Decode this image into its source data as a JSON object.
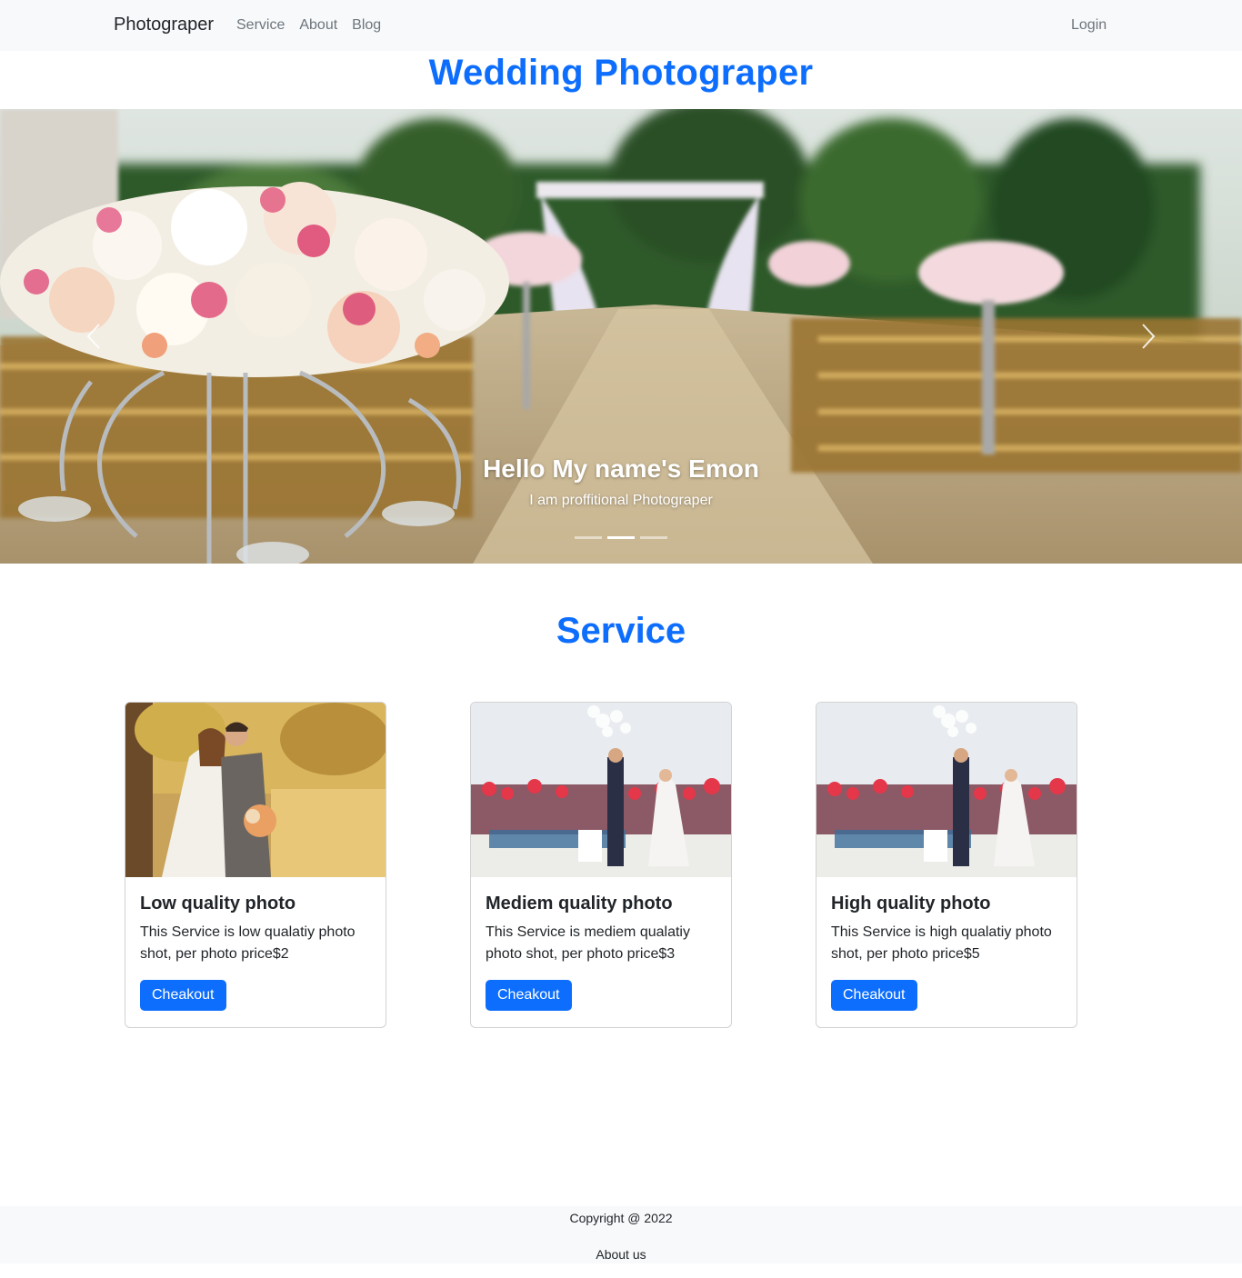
{
  "navbar": {
    "brand": "Photograper",
    "links": [
      "Service",
      "About",
      "Blog"
    ],
    "login": "Login"
  },
  "site_title": "Wedding Photograper",
  "carousel": {
    "caption_title": "Hello My name's Emon",
    "caption_text": "I am proffitional Photograper",
    "active_slide": 2,
    "slide_count": 3
  },
  "service": {
    "heading": "Service",
    "cards": [
      {
        "title": "Low quality photo",
        "text": "This Service is low qualatiy photo shot, per photo price$2",
        "button": "Cheakout"
      },
      {
        "title": "Mediem quality photo",
        "text": "This Service is mediem qualatiy photo shot, per photo price$3",
        "button": "Cheakout"
      },
      {
        "title": "High quality photo",
        "text": "This Service is high qualatiy photo shot, per photo price$5",
        "button": "Cheakout"
      }
    ]
  },
  "footer": {
    "copyright": "Copyright @ 2022",
    "about": "About us"
  },
  "colors": {
    "primary": "#0d6efd",
    "navbar_bg": "#f8f9fa",
    "muted_link": "#6c757d"
  }
}
